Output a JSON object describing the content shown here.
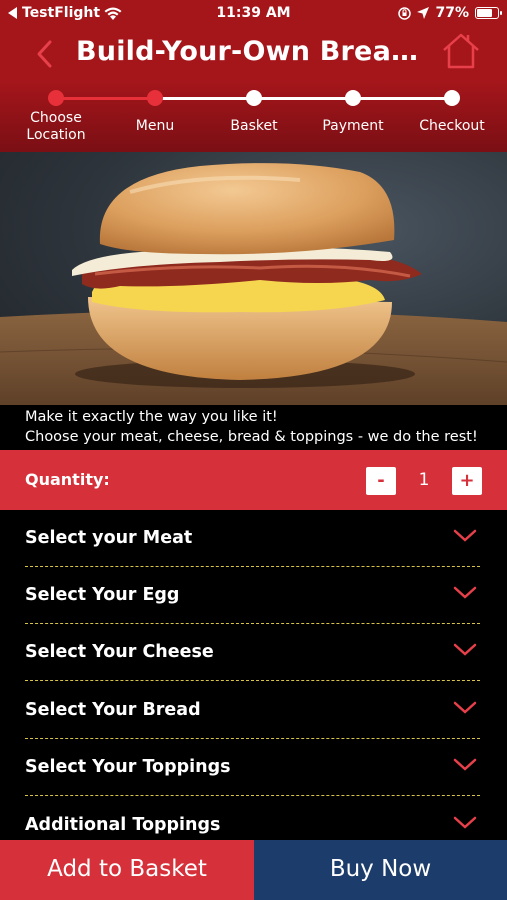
{
  "status_bar": {
    "carrier": "TestFlight",
    "time": "11:39 AM",
    "battery_percent": "77%",
    "battery_level": 0.77,
    "icons": [
      "back-arrow-icon",
      "wifi-icon",
      "orientation-lock-icon",
      "location-arrow-icon",
      "battery-icon"
    ]
  },
  "header": {
    "title": "Build-Your-Own Breakfast",
    "back_icon": "chevron-left-icon",
    "home_icon": "home-icon"
  },
  "steps": [
    {
      "label": "Choose Location",
      "state": "complete"
    },
    {
      "label": "Menu",
      "state": "current"
    },
    {
      "label": "Basket",
      "state": "pending"
    },
    {
      "label": "Payment",
      "state": "pending"
    },
    {
      "label": "Checkout",
      "state": "pending"
    }
  ],
  "description": {
    "line1": "Make it exactly the way you like it!",
    "line2": "Choose your meat, cheese, bread & toppings - we do the rest!"
  },
  "quantity": {
    "label": "Quantity:",
    "minus": "-",
    "value": "1",
    "plus": "+"
  },
  "options": [
    {
      "label": "Select your Meat"
    },
    {
      "label": "Select Your Egg"
    },
    {
      "label": "Select Your Cheese"
    },
    {
      "label": "Select Your Bread"
    },
    {
      "label": "Select Your Toppings"
    },
    {
      "label": "Additional Toppings"
    }
  ],
  "actions": {
    "add_to_basket": "Add to Basket",
    "buy_now": "Buy Now"
  },
  "colors": {
    "header_red": "#a5161b",
    "accent_red": "#d6313a",
    "navy": "#1c3c6b",
    "divider_yellow": "#d9c44a"
  }
}
